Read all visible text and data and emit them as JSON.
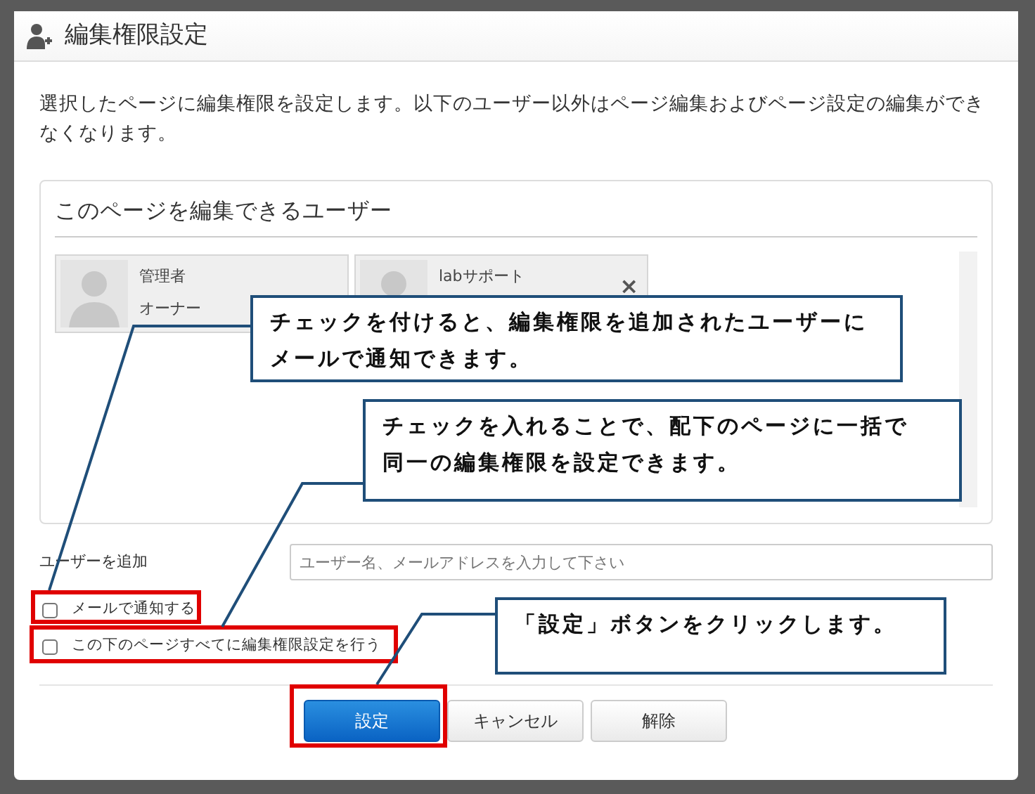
{
  "window": {
    "title": "編集権限設定"
  },
  "description": "選択したページに編集権限を設定します。以下のユーザー以外はページ編集およびページ設定の編集ができなくなります。",
  "editors_panel": {
    "title": "このページを編集できるユーザー",
    "users": [
      {
        "name": "管理者",
        "role": "オーナー"
      },
      {
        "name": "labサポート",
        "remove_glyph": "×"
      }
    ]
  },
  "add_user": {
    "label": "ユーザーを追加",
    "placeholder": "ユーザー名、メールアドレスを入力して下さい"
  },
  "options": [
    {
      "label": "メールで通知する",
      "checked": false
    },
    {
      "label": "この下のページすべてに編集権限設定を行う",
      "checked": false
    }
  ],
  "buttons": [
    {
      "label": "設定",
      "primary": true
    },
    {
      "label": "キャンセル",
      "primary": false
    },
    {
      "label": "解除",
      "primary": false
    }
  ],
  "annotations": [
    "チェックを付けると、編集権限を追加されたユーザーにメールで通知できます。",
    "チェックを入れることで、配下のページに一括で同一の編集権限を設定できます。",
    "「設定」ボタンをクリックします。"
  ]
}
